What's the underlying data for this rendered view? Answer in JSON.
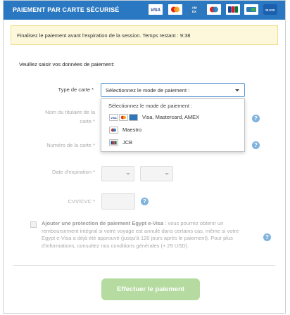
{
  "header": {
    "title": "PAIEMENT PAR CARTE SÉCURISÉ",
    "cards": [
      {
        "name": "visa",
        "label": "VISA"
      },
      {
        "name": "mastercard",
        "label": ""
      },
      {
        "name": "amex",
        "label": "AM EX"
      },
      {
        "name": "maestro",
        "label": ""
      },
      {
        "name": "jcb",
        "label": "JCB"
      },
      {
        "name": "cb",
        "label": "CB"
      },
      {
        "name": "e-bleue",
        "label": "BLEUE"
      }
    ]
  },
  "notice": {
    "text": "Finalisez le paiement avant l'expiration de la session. Temps restant : 9:38"
  },
  "form": {
    "intro": "Veuillez saisir vos données de paiement:",
    "card_type_label": "Type de carte *",
    "card_type_value": "Sélectionnez le mode de paiement :",
    "holder_label_1": "Nom du titulaire de la",
    "holder_label_2": "carte *",
    "card_number_label": "Numéro de la carte *",
    "expiry_label": "Date d'expiration *",
    "cvv_label": "CVV/CVC *",
    "help": "?"
  },
  "dropdown": {
    "header": "Sélectionnez le mode de paiement :",
    "options": [
      {
        "label": "Visa, Mastercard, AMEX"
      },
      {
        "label": "Maestro"
      },
      {
        "label": "JCB"
      }
    ]
  },
  "insurance": {
    "title": "Ajouter une protection de paiement Egypt e-Visa",
    "text": " : vous pourrez obtenir un remboursement intégral si votre voyage est annulé dans certains cas, même si votre Egypt e-Visa a déjà été approuvé (jusqu'à 120 jours après le paiement). Pour plus d'informations, consultez nos conditions générales (+ 29 USD)."
  },
  "submit": {
    "label": "Effectuer le paiement"
  },
  "colors": {
    "header": "#2a78c2",
    "notice_bg": "#fdf8dc",
    "button_disabled": "#b5dba0"
  }
}
